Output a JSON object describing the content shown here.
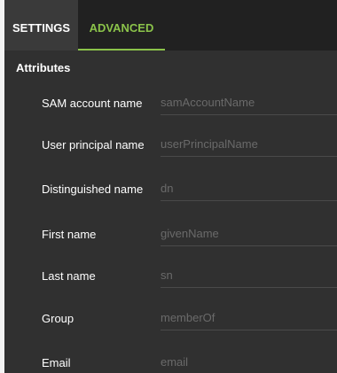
{
  "tabs": [
    {
      "label": "SETTINGS",
      "active": false
    },
    {
      "label": "ADVANCED",
      "active": true
    }
  ],
  "section": {
    "heading": "Attributes"
  },
  "fields": [
    {
      "label": "SAM account name",
      "value": "",
      "placeholder": "samAccountName"
    },
    {
      "label": "User principal name",
      "value": "",
      "placeholder": "userPrincipalName"
    },
    {
      "label": "Distinguished name",
      "value": "",
      "placeholder": "dn"
    },
    {
      "label": "First name",
      "value": "",
      "placeholder": "givenName"
    },
    {
      "label": "Last name",
      "value": "",
      "placeholder": "sn"
    },
    {
      "label": "Group",
      "value": "",
      "placeholder": "memberOf"
    },
    {
      "label": "Email",
      "value": "",
      "placeholder": "email"
    }
  ],
  "colors": {
    "accent": "#8bc34a",
    "panel_bg": "#303030",
    "tabbar_bg": "#212121"
  }
}
